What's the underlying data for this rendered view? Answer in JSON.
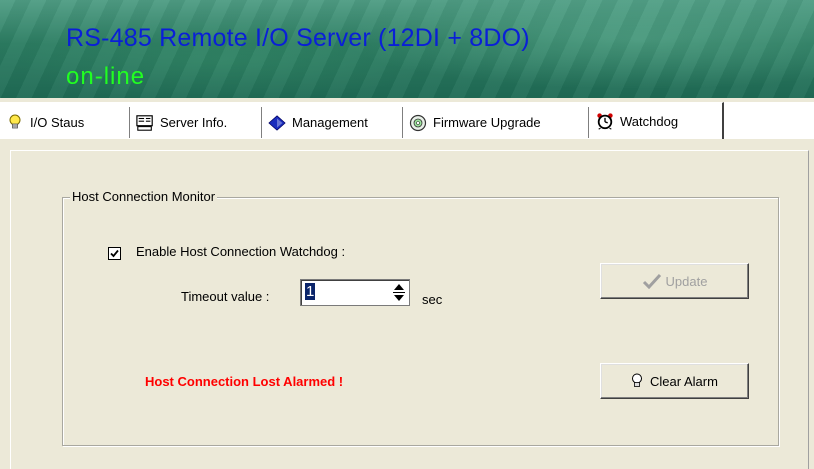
{
  "banner": {
    "title": "RS-485 Remote I/O Server (12DI + 8DO)",
    "status": "on-line",
    "title_color": "#0a1fd8",
    "status_color": "#21ff21"
  },
  "tabs": [
    {
      "label": "I/O Staus",
      "icon": "lightbulb-icon",
      "active": false
    },
    {
      "label": "Server Info.",
      "icon": "server-info-icon",
      "active": false
    },
    {
      "label": "Management",
      "icon": "management-diamond-icon",
      "active": false
    },
    {
      "label": "Firmware Upgrade",
      "icon": "firmware-disc-icon",
      "active": false
    },
    {
      "label": "Watchdog",
      "icon": "alarm-clock-icon",
      "active": true
    }
  ],
  "watchdog": {
    "group_title": "Host Connection Monitor",
    "enable_label": "Enable Host Connection Watchdog :",
    "enable_checked": true,
    "timeout_label": "Timeout value :",
    "timeout_value": "1",
    "timeout_unit": "sec",
    "update_label": "Update",
    "update_enabled": false,
    "clear_alarm_label": "Clear Alarm",
    "alarm_text": "Host Connection Lost Alarmed !",
    "alarm_color": "#ff0000"
  }
}
